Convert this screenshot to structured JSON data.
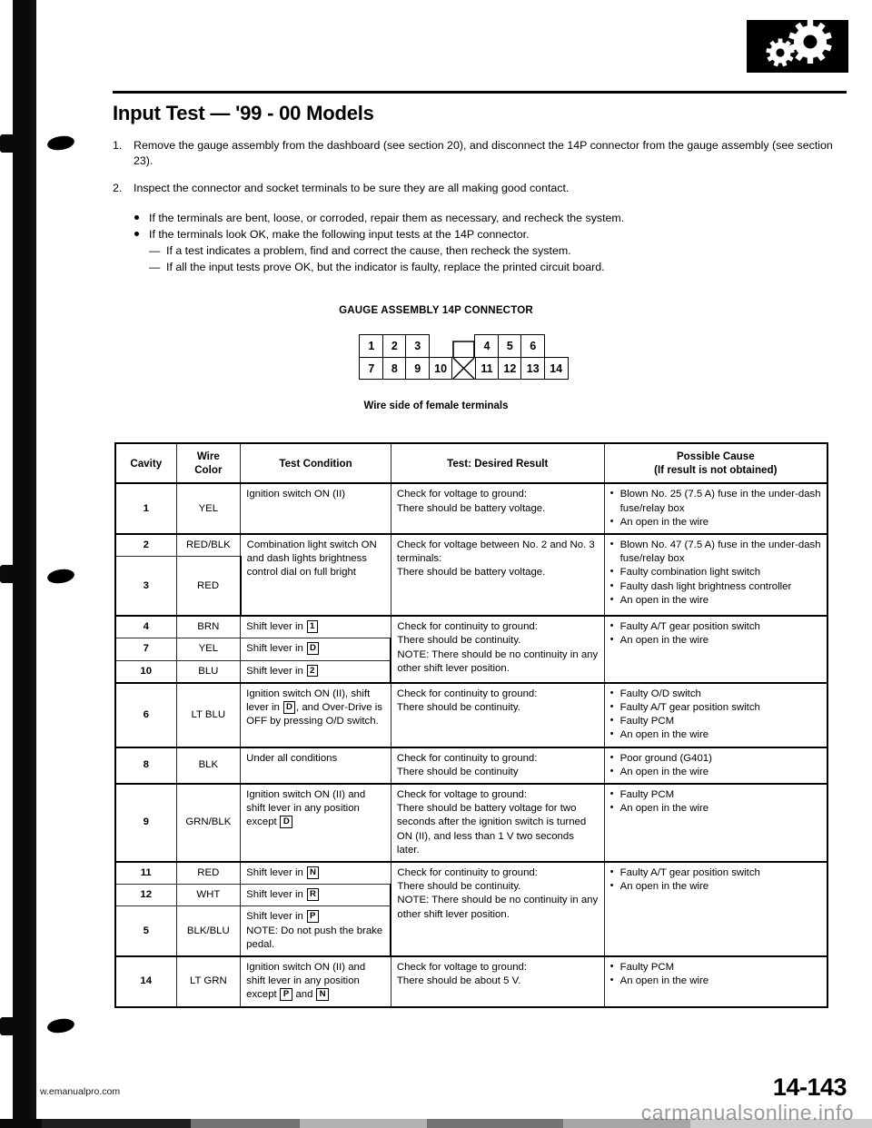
{
  "document": {
    "title": "Input Test — '99 - 00 Models",
    "page_number": "14-143",
    "footer_url": "w.emanualpro.com",
    "watermark": "carmanualsonline.info"
  },
  "steps": [
    {
      "num": "1.",
      "text": "Remove the gauge assembly from the dashboard (see section 20), and disconnect the 14P connector from the gauge assembly (see section 23)."
    },
    {
      "num": "2.",
      "text": "Inspect the connector and socket terminals to be sure they are all making good contact."
    }
  ],
  "bullets": [
    "If the terminals are bent, loose, or corroded, repair them as necessary, and recheck the system.",
    "If the terminals look OK, make the following input tests at the 14P connector."
  ],
  "dashes": [
    "If a test indicates a problem, find and correct the cause, then recheck the system.",
    "If all the input tests prove OK, but the indicator is faulty, replace the printed circuit board."
  ],
  "connector": {
    "caption": "GAUGE ASSEMBLY 14P CONNECTOR",
    "note": "Wire side of female terminals",
    "top_row": [
      "1",
      "2",
      "3",
      "",
      "",
      "4",
      "5",
      "6"
    ],
    "bottom_row": [
      "7",
      "8",
      "9",
      "10",
      "X",
      "11",
      "12",
      "13",
      "14"
    ]
  },
  "table": {
    "headers": {
      "cavity": "Cavity",
      "wire_color": "Wire\nColor",
      "wire_color_l1": "Wire",
      "wire_color_l2": "Color",
      "test_condition": "Test Condition",
      "test_result": "Test: Desired Result",
      "possible_cause_l1": "Possible Cause",
      "possible_cause_l2": "(If result is not obtained)"
    },
    "rows": [
      {
        "cavity": "1",
        "wire": "YEL",
        "condition": "Ignition switch ON (II)",
        "result": "Check for voltage to ground:\nThere should be battery voltage.",
        "causes": [
          "Blown No. 25 (7.5 A) fuse in the under-dash fuse/relay box",
          "An open in the wire"
        ]
      },
      {
        "cavity": "2",
        "wire": "RED/BLK",
        "condition": "Combination light switch ON and dash lights brightness control dial on full bright",
        "result": "Check for voltage between No. 2 and No. 3 terminals:\nThere should be battery voltage.",
        "causes": [
          "Blown No. 47 (7.5 A) fuse in the under-dash fuse/relay box",
          "Faulty combination light switch",
          "Faulty dash light brightness controller",
          "An open in the wire"
        ]
      },
      {
        "cavity": "3",
        "wire": "RED"
      },
      {
        "cavity": "4",
        "wire": "BRN",
        "condition_pre": "Shift lever in ",
        "gear": "1",
        "result": "Check for continuity to ground:\nThere should be continuity.\nNOTE:  There should be no continuity in any other shift lever position.",
        "causes": [
          "Faulty A/T gear position switch",
          "An open in the wire"
        ]
      },
      {
        "cavity": "7",
        "wire": "YEL",
        "condition_pre": "Shift lever in ",
        "gear": "D"
      },
      {
        "cavity": "10",
        "wire": "BLU",
        "condition_pre": "Shift lever in ",
        "gear": "2"
      },
      {
        "cavity": "6",
        "wire": "LT BLU",
        "condition_a": "Ignition switch ON (II), shift lever in ",
        "gear": "D",
        "condition_b": ", and Over-Drive is OFF by pressing O/D switch.",
        "result": "Check for continuity to ground:\nThere should be continuity.",
        "causes": [
          "Faulty O/D switch",
          "Faulty A/T gear position switch",
          "Faulty PCM",
          "An open in the wire"
        ]
      },
      {
        "cavity": "8",
        "wire": "BLK",
        "condition": "Under all conditions",
        "result": "Check for continuity to ground:\nThere should be continuity",
        "causes": [
          "Poor ground (G401)",
          "An open in the wire"
        ]
      },
      {
        "cavity": "9",
        "wire": "GRN/BLK",
        "condition_a": "Ignition switch ON (II) and shift lever in any position except ",
        "gear": "D",
        "condition_b": "",
        "result": "Check for voltage to ground:\nThere should be battery voltage for two seconds after the ignition switch is turned ON (II), and less than 1 V two seconds later.",
        "causes": [
          "Faulty PCM",
          "An open in the wire"
        ]
      },
      {
        "cavity": "11",
        "wire": "RED",
        "condition_pre": "Shift lever in ",
        "gear": "N",
        "result": "Check for continuity to ground:\nThere should be continuity.\nNOTE:  There should be no continuity in any other shift lever position.",
        "causes": [
          "Faulty A/T gear position switch",
          "An open in the wire"
        ]
      },
      {
        "cavity": "12",
        "wire": "WHT",
        "condition_pre": "Shift lever in ",
        "gear": "R"
      },
      {
        "cavity": "5",
        "wire": "BLK/BLU",
        "condition_pre": "Shift lever in ",
        "gear": "P",
        "condition_b": "NOTE:  Do not push the brake pedal."
      },
      {
        "cavity": "14",
        "wire": "LT GRN",
        "condition_a": "Ignition switch ON (II) and shift lever in any position except ",
        "gear": "P",
        "condition_mid": " and ",
        "gear2": "N",
        "result": "Check for voltage to ground:\nThere should be about 5 V.",
        "causes": [
          "Faulty PCM",
          "An open in the wire"
        ]
      }
    ]
  }
}
